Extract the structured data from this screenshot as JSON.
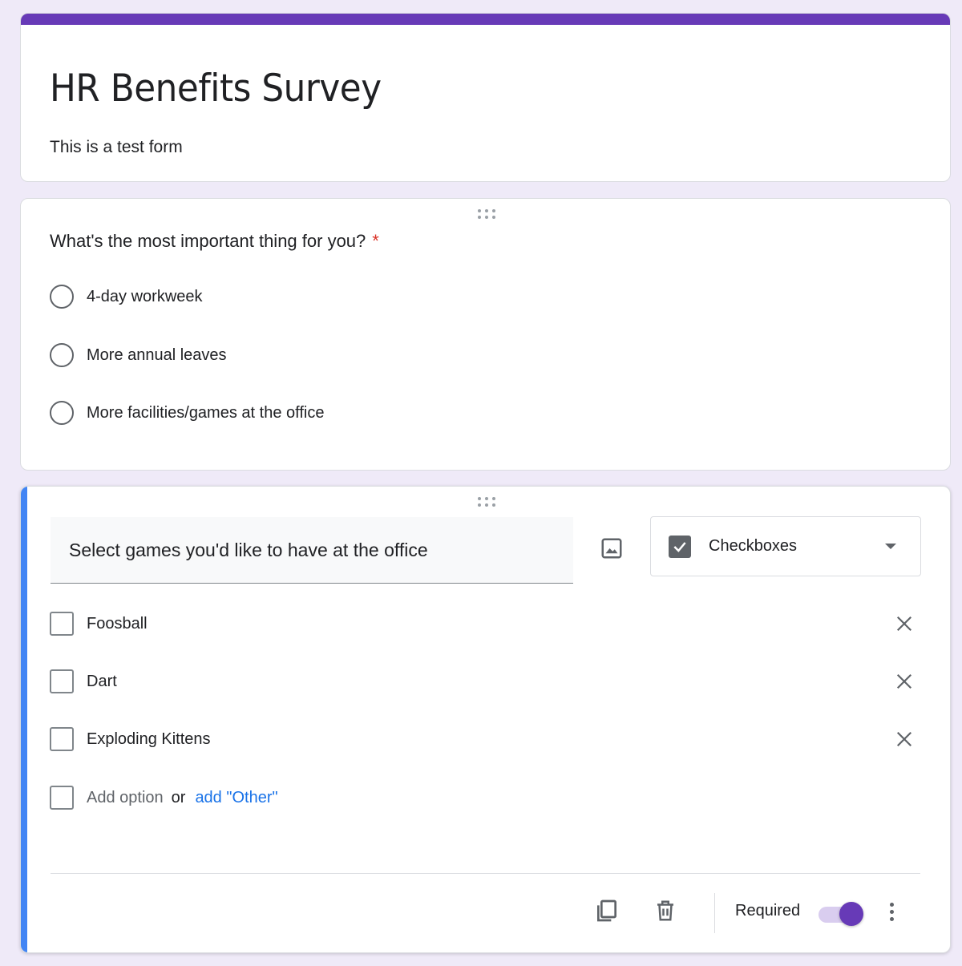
{
  "colors": {
    "accent": "#673ab7",
    "active_bar": "#4285f4",
    "required_star": "#d93025",
    "link": "#1a73e8",
    "background": "#efeaf8"
  },
  "form": {
    "title": "HR Benefits Survey",
    "description": "This is a test form"
  },
  "question1": {
    "title": "What's the most important thing for you?",
    "required_marker": "*",
    "options": [
      "4-day workweek",
      "More annual leaves",
      "More facilities/games at the office"
    ]
  },
  "question2": {
    "title": "Select games you'd like to have at the office",
    "type": "Checkboxes",
    "options": [
      "Foosball",
      "Dart",
      "Exploding Kittens"
    ],
    "add_option": "Add option",
    "or": "or",
    "add_other": "add \"Other\"",
    "required_label": "Required",
    "required_on": true
  },
  "icons": {
    "drag": "drag-handle-icon",
    "image": "image-icon",
    "type": "checkbox-icon",
    "dropdown": "chevron-down-icon",
    "remove": "close-icon",
    "duplicate": "copy-icon",
    "delete": "trash-icon",
    "more": "more-vertical-icon"
  }
}
